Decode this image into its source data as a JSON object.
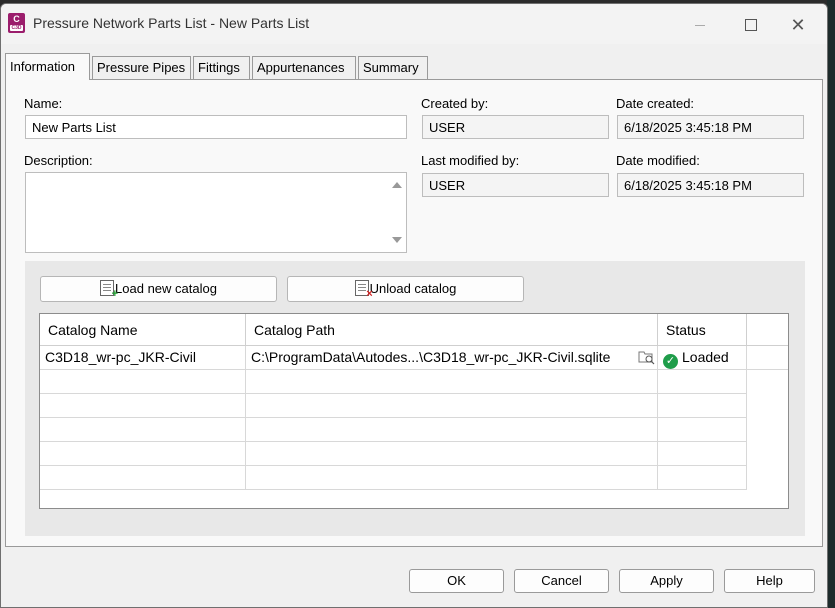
{
  "window": {
    "title": "Pressure Network Parts List - New Parts List",
    "icon_text": "C",
    "icon_subtext": "C3D"
  },
  "tabs": [
    {
      "label": "Information",
      "active": true
    },
    {
      "label": "Pressure Pipes",
      "active": false
    },
    {
      "label": "Fittings",
      "active": false
    },
    {
      "label": "Appurtenances",
      "active": false
    },
    {
      "label": "Summary",
      "active": false
    }
  ],
  "info": {
    "name_label": "Name:",
    "name_value": "New Parts List",
    "description_label": "Description:",
    "description_value": "",
    "created_by_label": "Created by:",
    "created_by_value": "USER",
    "date_created_label": "Date created:",
    "date_created_value": "6/18/2025 3:45:18 PM",
    "last_modified_by_label": "Last modified by:",
    "last_modified_by_value": "USER",
    "date_modified_label": "Date modified:",
    "date_modified_value": "6/18/2025 3:45:18 PM"
  },
  "catalog": {
    "load_label": "Load new catalog",
    "unload_label": "Unload catalog",
    "columns": [
      "Catalog Name",
      "Catalog Path",
      "Status"
    ],
    "rows": [
      {
        "name": "C3D18_wr-pc_JKR-Civil",
        "path": "C:\\ProgramData\\Autodes...\\C3D18_wr-pc_JKR-Civil.sqlite",
        "status": "Loaded",
        "status_icon": "check-circle-icon",
        "status_color": "#1f9d4a"
      }
    ]
  },
  "buttons": {
    "ok": "OK",
    "cancel": "Cancel",
    "apply": "Apply",
    "help": "Help"
  }
}
